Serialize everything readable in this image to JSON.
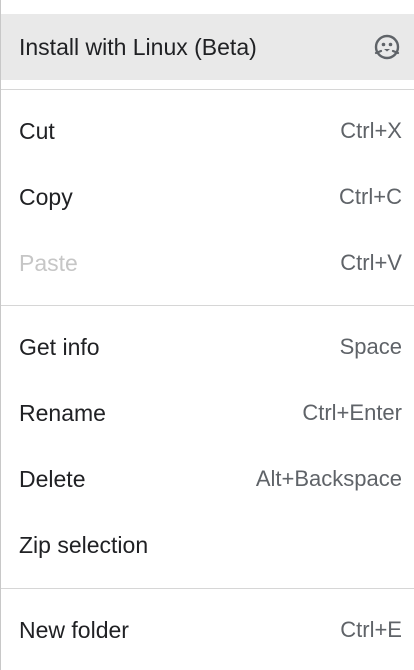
{
  "menu": {
    "install_linux": {
      "label": "Install with Linux (Beta)",
      "icon": "linux-penguin-icon"
    },
    "cut": {
      "label": "Cut",
      "shortcut": "Ctrl+X"
    },
    "copy": {
      "label": "Copy",
      "shortcut": "Ctrl+C"
    },
    "paste": {
      "label": "Paste",
      "shortcut": "Ctrl+V",
      "disabled": true
    },
    "get_info": {
      "label": "Get info",
      "shortcut": "Space"
    },
    "rename": {
      "label": "Rename",
      "shortcut": "Ctrl+Enter"
    },
    "delete": {
      "label": "Delete",
      "shortcut": "Alt+Backspace"
    },
    "zip_selection": {
      "label": "Zip selection"
    },
    "new_folder": {
      "label": "New folder",
      "shortcut": "Ctrl+E"
    }
  },
  "colors": {
    "highlight": "#e9e9e9",
    "text": "#202124",
    "shortcut": "#5f6368",
    "disabled_text": "#c6c6c6",
    "separator": "#d6d6d6"
  }
}
